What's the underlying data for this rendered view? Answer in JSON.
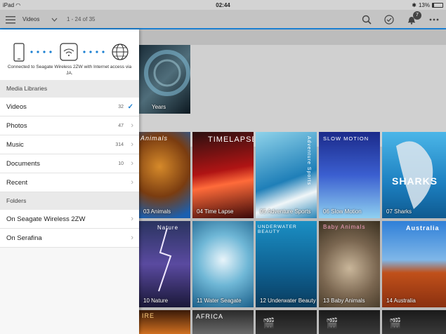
{
  "status": {
    "device": "iPad",
    "time": "02:44",
    "battery": "13%",
    "battery_level": 0.13
  },
  "toolbar": {
    "title": "Videos",
    "count": "1 - 24 of 35",
    "notifications": "7"
  },
  "featured": {
    "label": "Years"
  },
  "tiles": [
    {
      "label": "03 Animals",
      "overlay": "Animals"
    },
    {
      "label": "04 Time Lapse",
      "overlay": "TIMELAPSE"
    },
    {
      "label": "05 Adventure Sports",
      "overlay": "Adventure Sports"
    },
    {
      "label": "06 Slow Motion",
      "overlay": "SLOW MOTION"
    },
    {
      "label": "07 Sharks",
      "overlay": "SHARKS"
    },
    {
      "label": "10 Nature",
      "overlay": "Nature"
    },
    {
      "label": "11 Water Seagate",
      "overlay": ""
    },
    {
      "label": "12 Underwater Beauty",
      "overlay": "UNDERWATER BEAUTY"
    },
    {
      "label": "13 Baby Animals",
      "overlay": "Baby Animals"
    },
    {
      "label": "14 Australia",
      "overlay": "Australia"
    },
    {
      "label": "",
      "overlay": "IRE"
    },
    {
      "label": "",
      "overlay": "AFRICA"
    }
  ],
  "drawer": {
    "connection_text": "Connected to Seagate Wireless 2ZW with Internet access via JA.",
    "media_header": "Media Libraries",
    "media": [
      {
        "label": "Videos",
        "count": "32",
        "selected": true
      },
      {
        "label": "Photos",
        "count": "47"
      },
      {
        "label": "Music",
        "count": "314"
      },
      {
        "label": "Documents",
        "count": "10"
      },
      {
        "label": "Recent",
        "count": ""
      }
    ],
    "folders_header": "Folders",
    "folders": [
      {
        "label": "On Seagate Wireless 2ZW"
      },
      {
        "label": "On Serafina"
      }
    ]
  },
  "colors": {
    "accent": "#1a7fd1"
  }
}
